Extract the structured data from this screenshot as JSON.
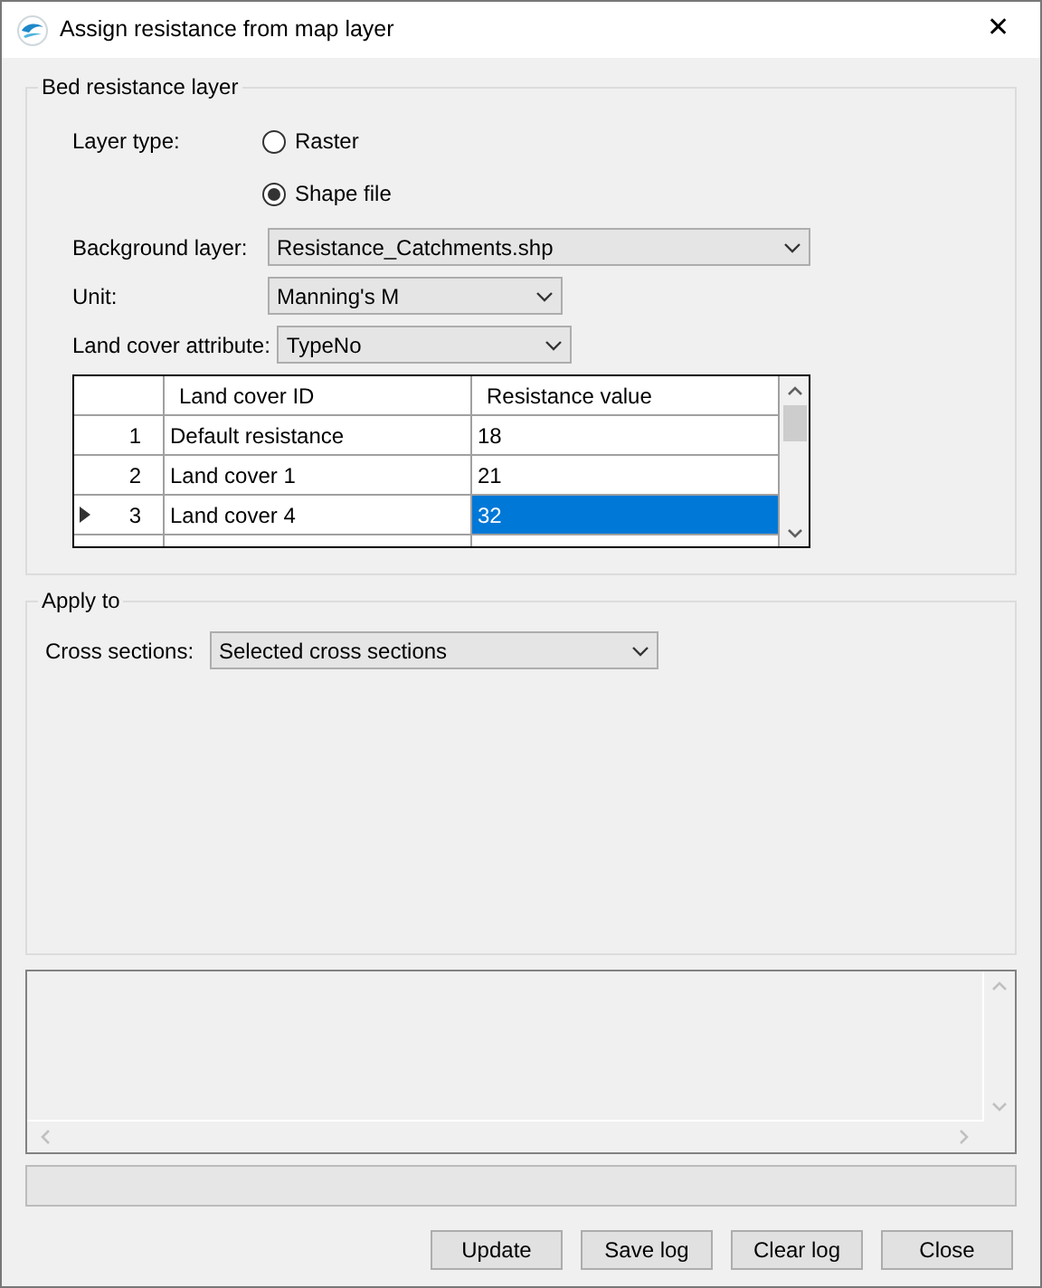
{
  "window": {
    "title": "Assign resistance from map layer",
    "close": "✕"
  },
  "bed_resistance_layer": {
    "title": "Bed resistance layer",
    "layer_type_label": "Layer type:",
    "layer_types": [
      {
        "label": "Raster",
        "selected": false
      },
      {
        "label": "Shape file",
        "selected": true
      }
    ],
    "background_layer": {
      "label": "Background layer:",
      "value": "Resistance_Catchments.shp"
    },
    "unit": {
      "label": "Unit:",
      "value": "Manning's M"
    },
    "land_cover_attribute": {
      "label": "Land cover attribute:",
      "value": "TypeNo"
    },
    "table": {
      "columns": [
        "Land cover ID",
        "Resistance value"
      ],
      "rows": [
        {
          "index": "1",
          "id": "Default resistance",
          "value": "18",
          "current": false,
          "selected": false
        },
        {
          "index": "2",
          "id": "Land cover 1",
          "value": "21",
          "current": false,
          "selected": false
        },
        {
          "index": "3",
          "id": "Land cover 4",
          "value": "32",
          "current": true,
          "selected": true
        }
      ]
    }
  },
  "apply_to": {
    "title": "Apply to",
    "cross_sections": {
      "label": "Cross sections:",
      "value": "Selected cross sections"
    }
  },
  "buttons": [
    "Update",
    "Save log",
    "Clear log",
    "Close"
  ]
}
